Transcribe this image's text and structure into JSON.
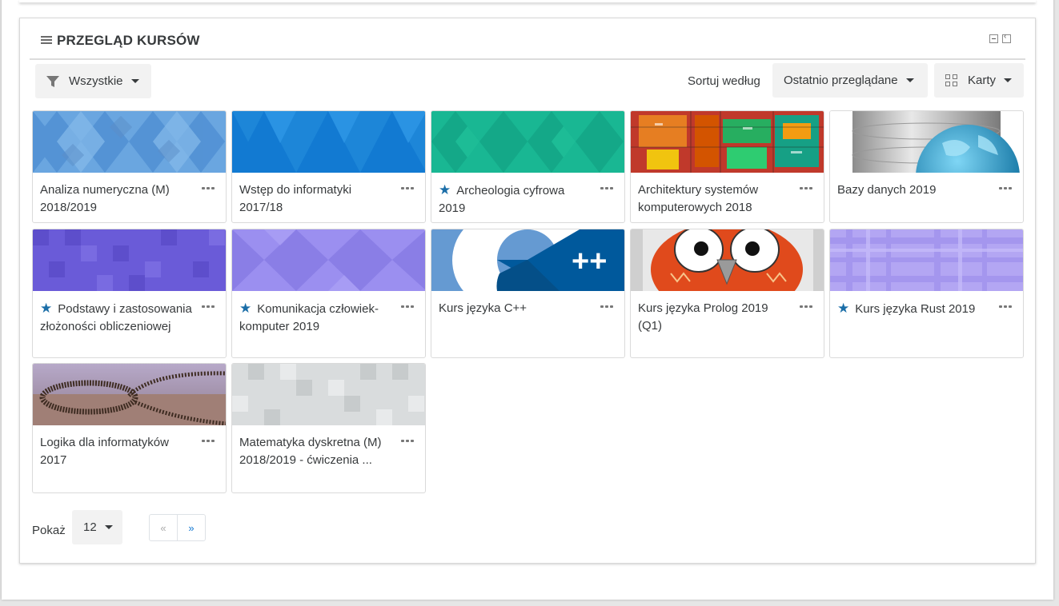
{
  "block": {
    "title": "PRZEGLĄD KURSÓW"
  },
  "toolbar": {
    "filter_label": "Wszystkie",
    "sort_prefix": "Sortuj według",
    "sort_value": "Ostatnio przeglądane",
    "view_label": "Karty"
  },
  "courses": [
    {
      "name": "Analiza numeryczna (M) 2018/2019",
      "starred": false,
      "image": "pattern-blue-light"
    },
    {
      "name": "Wstęp do informatyki 2017/18",
      "starred": false,
      "image": "pattern-blue"
    },
    {
      "name": "Archeologia cyfrowa 2019",
      "starred": true,
      "image": "pattern-teal"
    },
    {
      "name": "Architektury systemów komputerowych 2018",
      "starred": false,
      "image": "chip-die-photo"
    },
    {
      "name": "Bazy danych 2019",
      "starred": false,
      "image": "database-globe"
    },
    {
      "name": "Podstawy i zastosowania złożoności obliczeniowej",
      "starred": true,
      "image": "pattern-purple"
    },
    {
      "name": "Komunikacja człowiek-komputer 2019",
      "starred": true,
      "image": "pattern-lavender"
    },
    {
      "name": "Kurs języka C++",
      "starred": false,
      "image": "cpp-logo"
    },
    {
      "name": "Kurs języka Prolog 2019 (Q1)",
      "starred": false,
      "image": "owl"
    },
    {
      "name": "Kurs języka Rust 2019",
      "starred": true,
      "image": "pattern-lilac-plaid"
    },
    {
      "name": "Logika dla informatyków 2017",
      "starred": false,
      "image": "dominoes"
    },
    {
      "name": "Matematyka dyskretna (M) 2018/2019 - ćwiczenia ...",
      "starred": false,
      "image": "pattern-grey"
    }
  ],
  "pagination": {
    "show_label": "Pokaż",
    "per_page": "12",
    "prev": "«",
    "next": "»"
  },
  "colors": {
    "star": "#1b6ea8",
    "link_accent": "#1177d1"
  }
}
